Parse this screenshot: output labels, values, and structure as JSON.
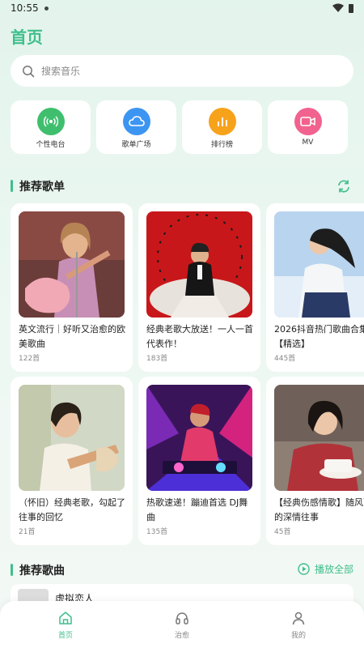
{
  "status": {
    "time": "10:55"
  },
  "page_title": "首页",
  "search": {
    "placeholder": "搜索音乐",
    "value": ""
  },
  "quick_links": [
    {
      "label": "个性电台",
      "icon": "radio-icon",
      "color": "#3fbf6e"
    },
    {
      "label": "歌单广场",
      "icon": "cloud-icon",
      "color": "#3d95f2"
    },
    {
      "label": "排行榜",
      "icon": "chart-bars-icon",
      "color": "#f7a21b"
    },
    {
      "label": "MV",
      "icon": "video-camera-icon",
      "color": "#f2628e"
    }
  ],
  "recommended_playlists": {
    "title": "推荐歌单",
    "items": [
      {
        "name": "英文流行｜好听又治愈的欧美歌曲",
        "count": "122首"
      },
      {
        "name": "经典老歌大放送！一人一首代表作！",
        "count": "183首"
      },
      {
        "name": "2026抖音热门歌曲合集【精选】",
        "count": "445首"
      },
      {
        "name": "（怀旧）经典老歌，勾起了往事的回忆",
        "count": "21首"
      },
      {
        "name": "热歌速递！蹦迪首选 DJ舞曲",
        "count": "135首"
      },
      {
        "name": "【经典伤感情歌】随风而去的深情往事",
        "count": "45首"
      }
    ]
  },
  "recommended_songs": {
    "title": "推荐歌曲",
    "play_all_label": "播放全部",
    "items": [
      {
        "title": "虚拟恋人"
      }
    ]
  },
  "bottom_nav": [
    {
      "label": "首页",
      "icon": "home-icon",
      "active": true
    },
    {
      "label": "治愈",
      "icon": "headphones-icon",
      "active": false
    },
    {
      "label": "我的",
      "icon": "person-icon",
      "active": false
    }
  ],
  "colors": {
    "accent": "#3fbf8c",
    "background": "#e6f5ee"
  }
}
